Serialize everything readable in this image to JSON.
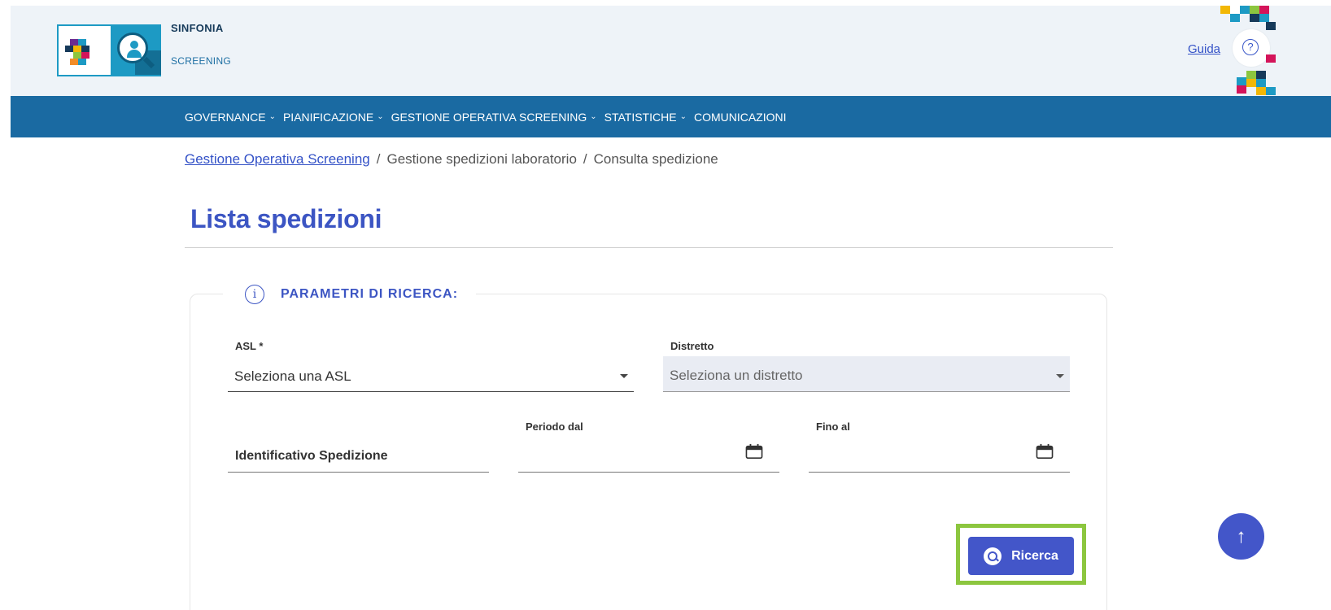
{
  "header": {
    "brand_title": "SINFONIA",
    "brand_subtitle": "SCREENING",
    "guida_link": "Guida",
    "help_glyph": "?"
  },
  "navbar": {
    "items": [
      {
        "label": "GOVERNANCE",
        "has_dropdown": true
      },
      {
        "label": "PIANIFICAZIONE",
        "has_dropdown": true
      },
      {
        "label": "GESTIONE OPERATIVA SCREENING",
        "has_dropdown": true
      },
      {
        "label": "STATISTICHE",
        "has_dropdown": true
      },
      {
        "label": "COMUNICAZIONI",
        "has_dropdown": false
      }
    ]
  },
  "breadcrumb": {
    "items": [
      "Gestione Operativa Screening",
      "Gestione spedizioni laboratorio",
      "Consulta spedizione"
    ],
    "separator": "/"
  },
  "page": {
    "title": "Lista spedizioni"
  },
  "search": {
    "legend": "PARAMETRI DI RICERCA:",
    "info_glyph": "i",
    "asl_label": "ASL *",
    "asl_value": "Seleziona una ASL",
    "distretto_label": "Distretto",
    "distretto_value": "Seleziona un distretto",
    "id_spedizione_placeholder": "Identificativo Spedizione",
    "periodo_dal_label": "Periodo dal",
    "fino_al_label": "Fino al",
    "button_label": "Ricerca"
  },
  "to_top_glyph": "↑",
  "colors": {
    "header_bg": "#eef3f8",
    "navbar_bg": "#1a6aa2",
    "primary": "#4356c9",
    "title": "#3c55c3",
    "highlight": "#8cc63f"
  }
}
